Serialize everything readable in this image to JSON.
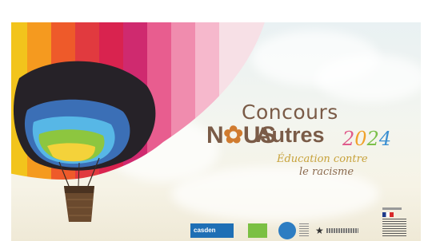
{
  "banner": {
    "title_line1": "Concours",
    "title_nous": "N",
    "title_nous_rest": "US",
    "title_autres": "Autres",
    "year_digits": [
      "2",
      "0",
      "2",
      "4"
    ],
    "subtitle_line1": "Éducation contre",
    "subtitle_line2": "le racisme"
  },
  "partners": {
    "casden_label": "casden"
  },
  "colors": {
    "title_brown": "#7a5b47",
    "subtitle_gold": "#c7a23a",
    "casden_blue": "#1e6fb5",
    "green_logo": "#7bc043"
  }
}
